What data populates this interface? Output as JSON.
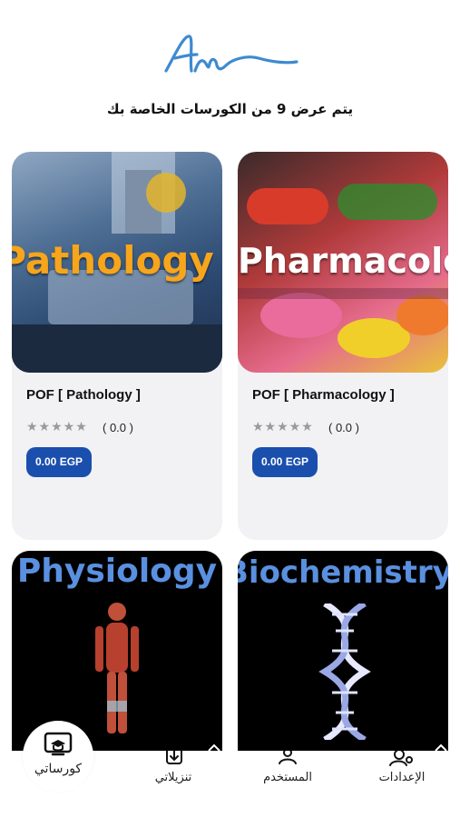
{
  "header": {
    "logo_name": "signature-logo",
    "subtitle": "يتم عرض 9 من الكورسات الخاصة بك"
  },
  "courses": [
    {
      "thumb_text": "Pathology",
      "title": "POF [ Pathology ]",
      "stars": "★★★★★",
      "rating": "( 0.0 )",
      "price": "0.00 EGP"
    },
    {
      "thumb_text": "Pharmacology",
      "title": "POF [ Pharmacology ]",
      "stars": "★★★★★",
      "rating": "( 0.0 )",
      "price": "0.00 EGP"
    },
    {
      "thumb_text": "Physiology"
    },
    {
      "thumb_text": "Biochemistry"
    }
  ],
  "nav": {
    "my_courses": "كورساتي",
    "downloads": "تنزيلاتي",
    "user": "المستخدم",
    "settings": "الإعدادات"
  },
  "colors": {
    "accent": "#1b4fae",
    "logo_blue": "#3d8ad0",
    "card_bg": "#f2f2f4"
  }
}
